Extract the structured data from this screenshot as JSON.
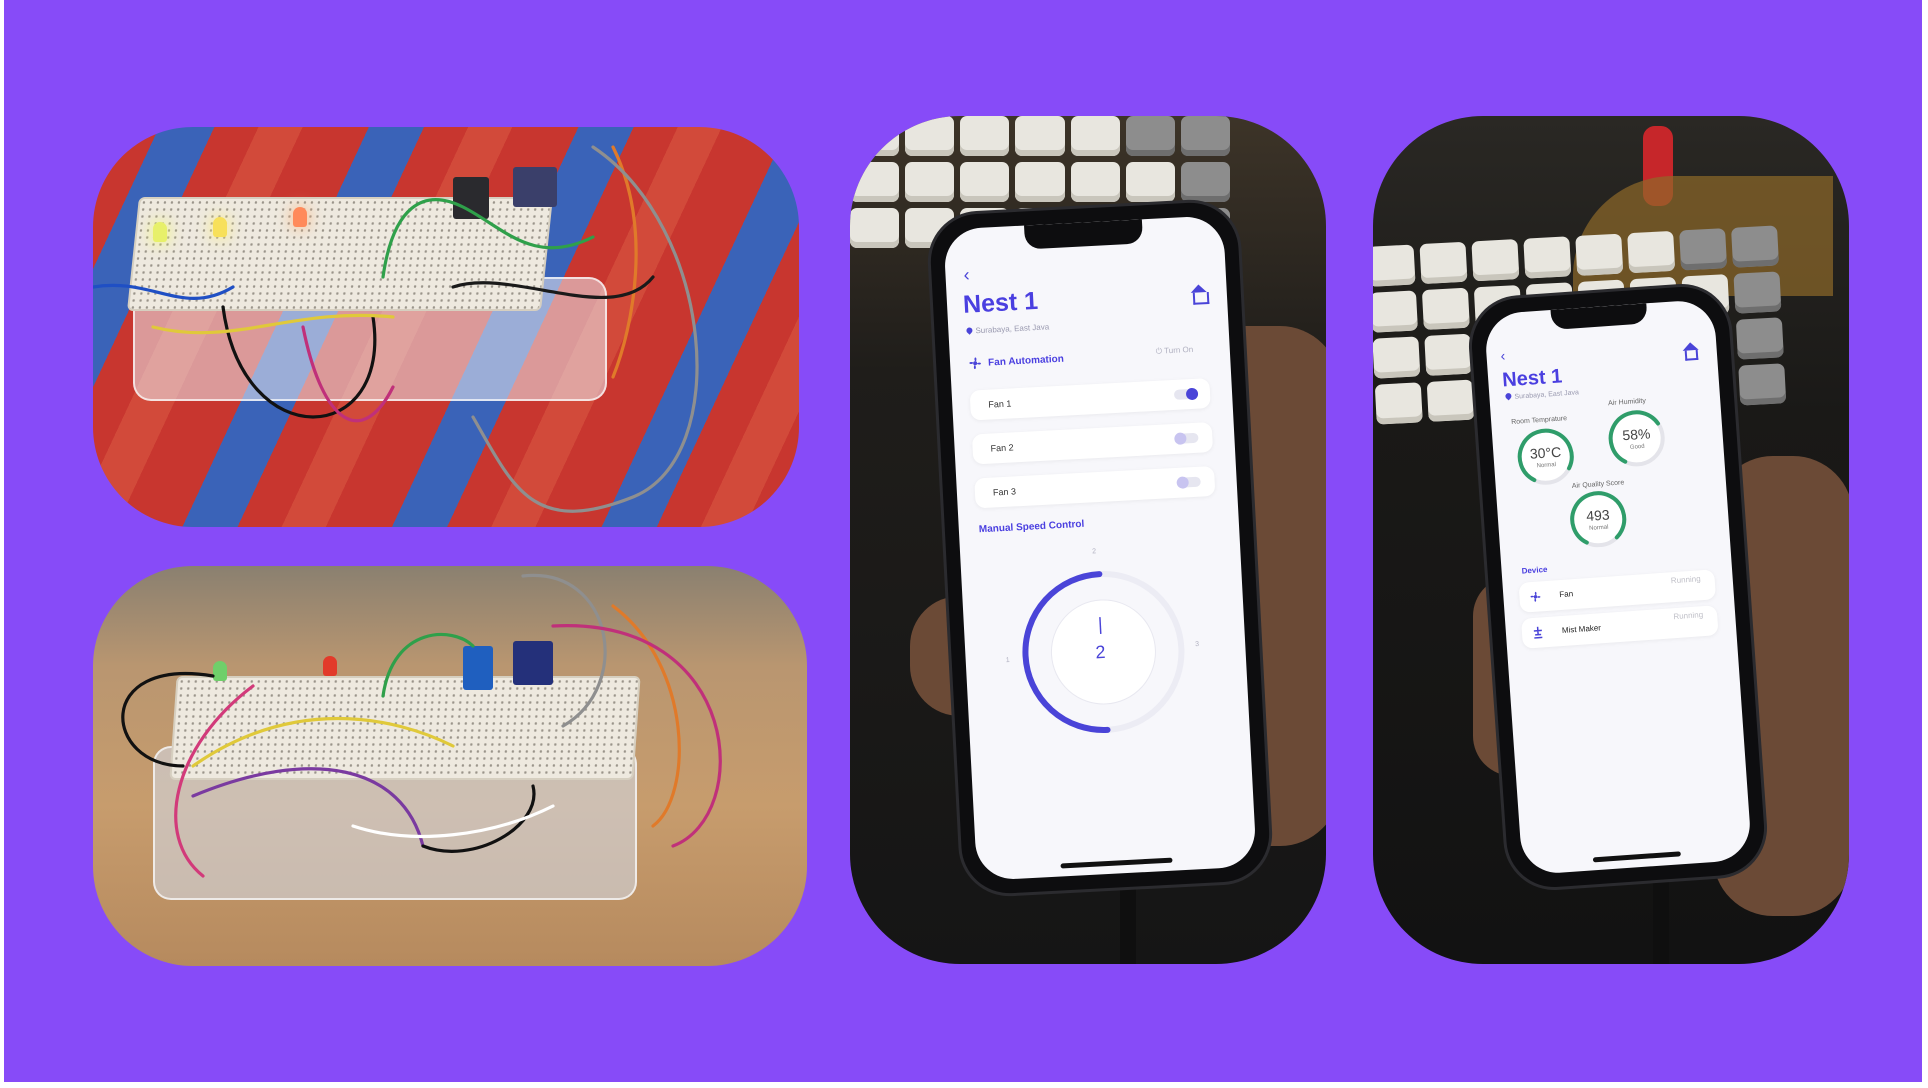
{
  "colors": {
    "background": "#874bf8",
    "accent": "#4a3fe0",
    "gauge_green": "#2f9d6a",
    "dial_blue": "#4a44d8"
  },
  "app_fan": {
    "back_icon": "chevron-left-icon",
    "title": "Nest 1",
    "location": "Surabaya, East Java",
    "home_icon": "home-icon",
    "automation_label": "Fan Automation",
    "automation_icon": "fan-icon",
    "power_label": "Turn On",
    "fans": [
      {
        "label": "Fan 1",
        "on": true
      },
      {
        "label": "Fan 2",
        "on": false
      },
      {
        "label": "Fan 3",
        "on": false
      }
    ],
    "speed_title": "Manual Speed Control",
    "dial": {
      "value": "2",
      "current_marker": "|",
      "min": "1",
      "mid": "2",
      "max": "3"
    }
  },
  "app_status": {
    "back_icon": "chevron-left-icon",
    "title": "Nest 1",
    "location": "Surabaya, East Java",
    "home_icon": "home-icon",
    "gauges": [
      {
        "label": "Room Temprature",
        "value": "30°C",
        "status": "Normal",
        "level": 0.75
      },
      {
        "label": "Air Humidity",
        "value": "58%",
        "status": "Good",
        "level": 0.58
      },
      {
        "label": "Air Quality Score",
        "value": "493",
        "status": "Normal",
        "level": 0.8
      }
    ],
    "device_title": "Device",
    "devices": [
      {
        "name": "Fan",
        "status": "Running",
        "icon": "fan-icon"
      },
      {
        "name": "Mist Maker",
        "status": "Running",
        "icon": "mist-maker-icon"
      }
    ]
  }
}
